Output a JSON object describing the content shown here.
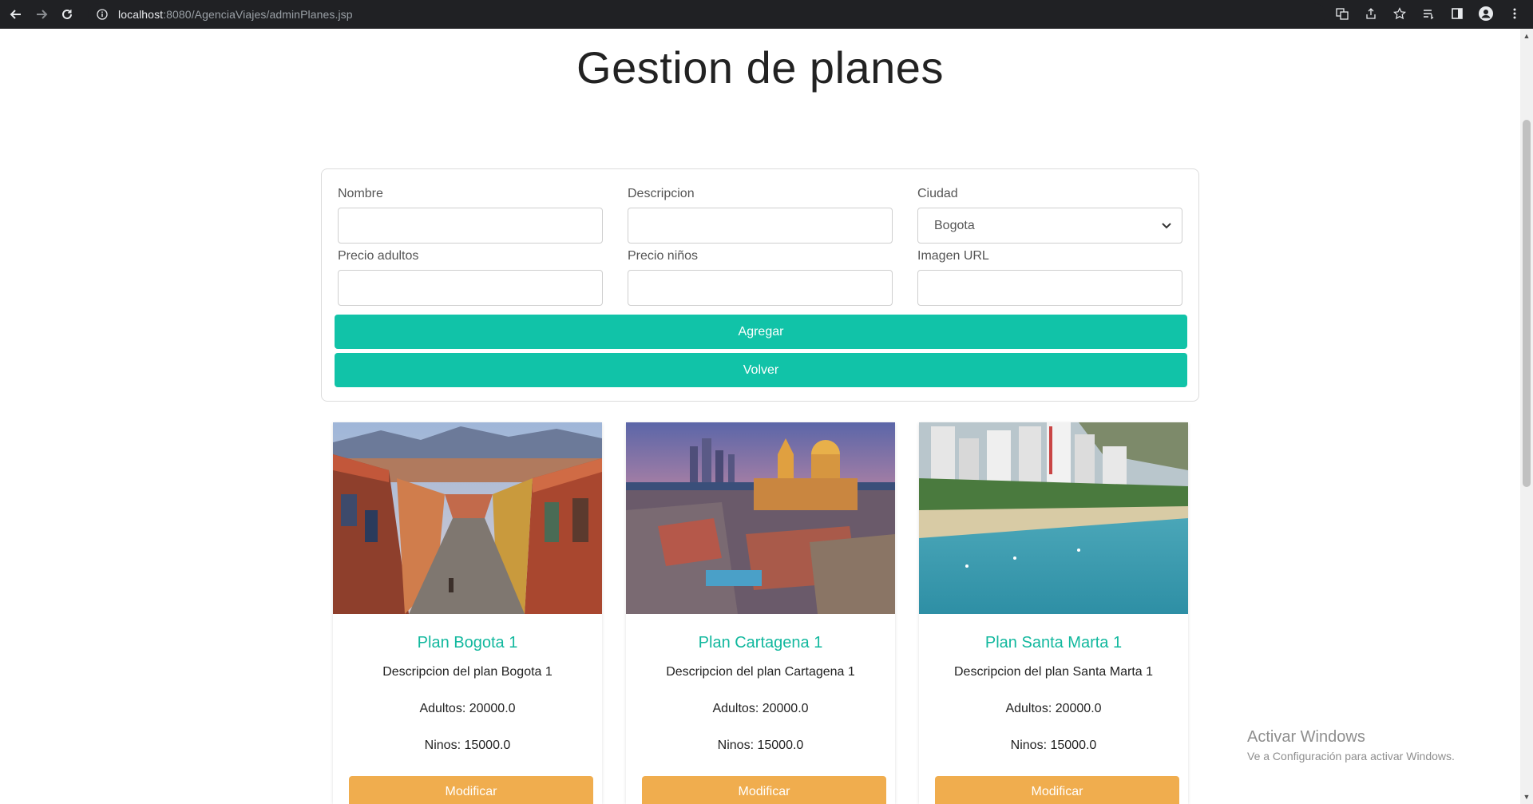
{
  "browser": {
    "url_host": "localhost",
    "url_rest": ":8080/AgenciaViajes/adminPlanes.jsp"
  },
  "page": {
    "title": "Gestion de planes"
  },
  "form": {
    "nombre_label": "Nombre",
    "descripcion_label": "Descripcion",
    "ciudad_label": "Ciudad",
    "ciudad_value": "Bogota",
    "precio_adultos_label": "Precio adultos",
    "precio_ninos_label": "Precio niños",
    "imagen_label": "Imagen URL",
    "agregar_label": "Agregar",
    "volver_label": "Volver"
  },
  "cards": [
    {
      "title": "Plan Bogota 1",
      "description": "Descripcion del plan Bogota 1",
      "adultos": "Adultos: 20000.0",
      "ninos": "Ninos: 15000.0",
      "button": "Modificar"
    },
    {
      "title": "Plan Cartagena 1",
      "description": "Descripcion del plan Cartagena 1",
      "adultos": "Adultos: 20000.0",
      "ninos": "Ninos: 15000.0",
      "button": "Modificar"
    },
    {
      "title": "Plan Santa Marta 1",
      "description": "Descripcion del plan Santa Marta 1",
      "adultos": "Adultos: 20000.0",
      "ninos": "Ninos: 15000.0",
      "button": "Modificar"
    }
  ],
  "watermark": {
    "title": "Activar Windows",
    "subtitle": "Ve a Configuración para activar Windows."
  },
  "colors": {
    "accent_teal": "#11c3a8",
    "button_orange": "#f0ad4e",
    "card_title": "#12b89e"
  }
}
